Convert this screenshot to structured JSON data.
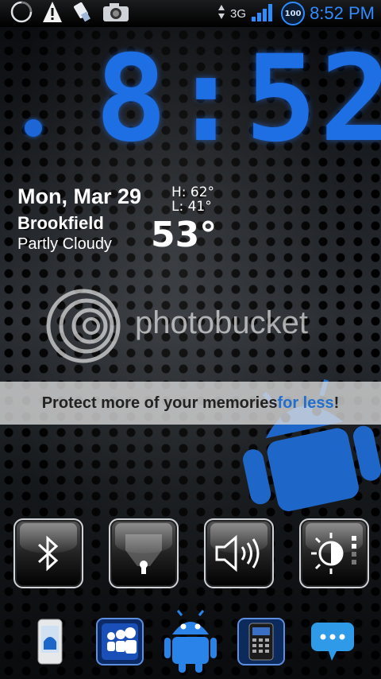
{
  "status_bar": {
    "network": "3G",
    "battery": "100",
    "time": "8:52 PM",
    "icons": [
      "circle-icon",
      "warning-icon",
      "usb-icon",
      "camera-icon",
      "data-arrows-icon",
      "signal-icon",
      "battery-icon"
    ]
  },
  "clock": {
    "time": "8:52"
  },
  "weather": {
    "date": "Mon, Mar 29",
    "city": "Brookfield",
    "condition": "Partly Cloudy",
    "high": "H: 62°",
    "low": "L:  41°",
    "temperature": "53°"
  },
  "watermark": {
    "brand": "photobucket",
    "banner_main": "Protect more of your memories ",
    "banner_accent": "for less",
    "banner_end": "!"
  },
  "toggles": [
    {
      "name": "bluetooth",
      "icon": "bluetooth-icon"
    },
    {
      "name": "gps",
      "icon": "gps-icon"
    },
    {
      "name": "sound",
      "icon": "speaker-icon"
    },
    {
      "name": "brightness",
      "icon": "brightness-icon"
    }
  ],
  "dock": [
    {
      "name": "phone-app",
      "icon": "phone-android-icon"
    },
    {
      "name": "myspace-app",
      "icon": "myspace-icon"
    },
    {
      "name": "launcher-app",
      "icon": "android-icon"
    },
    {
      "name": "dialer-app",
      "icon": "dialpad-icon"
    },
    {
      "name": "messaging-app",
      "icon": "message-icon"
    }
  ],
  "colors": {
    "accent": "#1d6fe3",
    "status_accent": "#2f8cff"
  }
}
